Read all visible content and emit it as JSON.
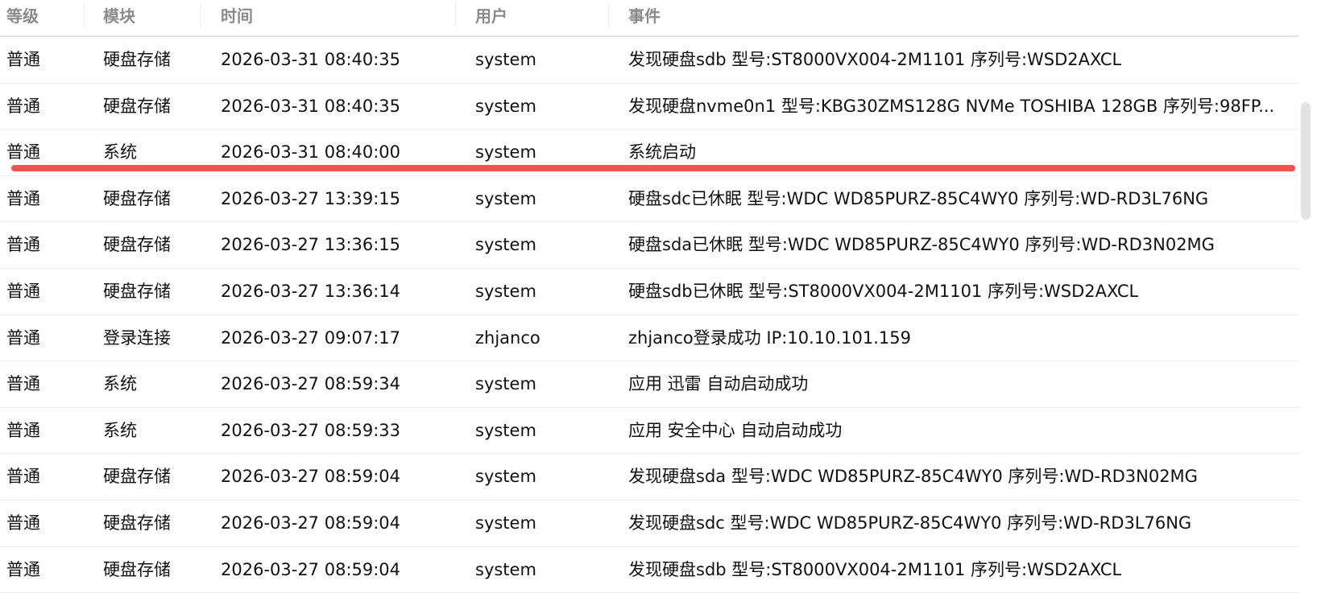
{
  "columns": [
    "等级",
    "模块",
    "时间",
    "用户",
    "事件"
  ],
  "rows": [
    {
      "level": "普通",
      "module": "硬盘存储",
      "time": "2026-03-31 08:40:35",
      "user": "system",
      "event": "发现硬盘sdb 型号:ST8000VX004-2M1101 序列号:WSD2AXCL"
    },
    {
      "level": "普通",
      "module": "硬盘存储",
      "time": "2026-03-31 08:40:35",
      "user": "system",
      "event": "发现硬盘nvme0n1 型号:KBG30ZMS128G NVMe TOSHIBA 128GB 序列号:98FP..."
    },
    {
      "level": "普通",
      "module": "系统",
      "time": "2026-03-31 08:40:00",
      "user": "system",
      "event": "系统启动"
    },
    {
      "level": "普通",
      "module": "硬盘存储",
      "time": "2026-03-27 13:39:15",
      "user": "system",
      "event": "硬盘sdc已休眠 型号:WDC WD85PURZ-85C4WY0 序列号:WD-RD3L76NG"
    },
    {
      "level": "普通",
      "module": "硬盘存储",
      "time": "2026-03-27 13:36:15",
      "user": "system",
      "event": "硬盘sda已休眠 型号:WDC WD85PURZ-85C4WY0 序列号:WD-RD3N02MG"
    },
    {
      "level": "普通",
      "module": "硬盘存储",
      "time": "2026-03-27 13:36:14",
      "user": "system",
      "event": "硬盘sdb已休眠 型号:ST8000VX004-2M1101 序列号:WSD2AXCL"
    },
    {
      "level": "普通",
      "module": "登录连接",
      "time": "2026-03-27 09:07:17",
      "user": "zhjanco",
      "event": "zhjanco登录成功 IP:10.10.101.159"
    },
    {
      "level": "普通",
      "module": "系统",
      "time": "2026-03-27 08:59:34",
      "user": "system",
      "event": "应用 迅雷 自动启动成功"
    },
    {
      "level": "普通",
      "module": "系统",
      "time": "2026-03-27 08:59:33",
      "user": "system",
      "event": "应用 安全中心 自动启动成功"
    },
    {
      "level": "普通",
      "module": "硬盘存储",
      "time": "2026-03-27 08:59:04",
      "user": "system",
      "event": "发现硬盘sda 型号:WDC WD85PURZ-85C4WY0 序列号:WD-RD3N02MG"
    },
    {
      "level": "普通",
      "module": "硬盘存储",
      "time": "2026-03-27 08:59:04",
      "user": "system",
      "event": "发现硬盘sdc 型号:WDC WD85PURZ-85C4WY0 序列号:WD-RD3L76NG"
    },
    {
      "level": "普通",
      "module": "硬盘存储",
      "time": "2026-03-27 08:59:04",
      "user": "system",
      "event": "发现硬盘sdb 型号:ST8000VX004-2M1101 序列号:WSD2AXCL"
    }
  ],
  "highlight_color": "#fb5050"
}
